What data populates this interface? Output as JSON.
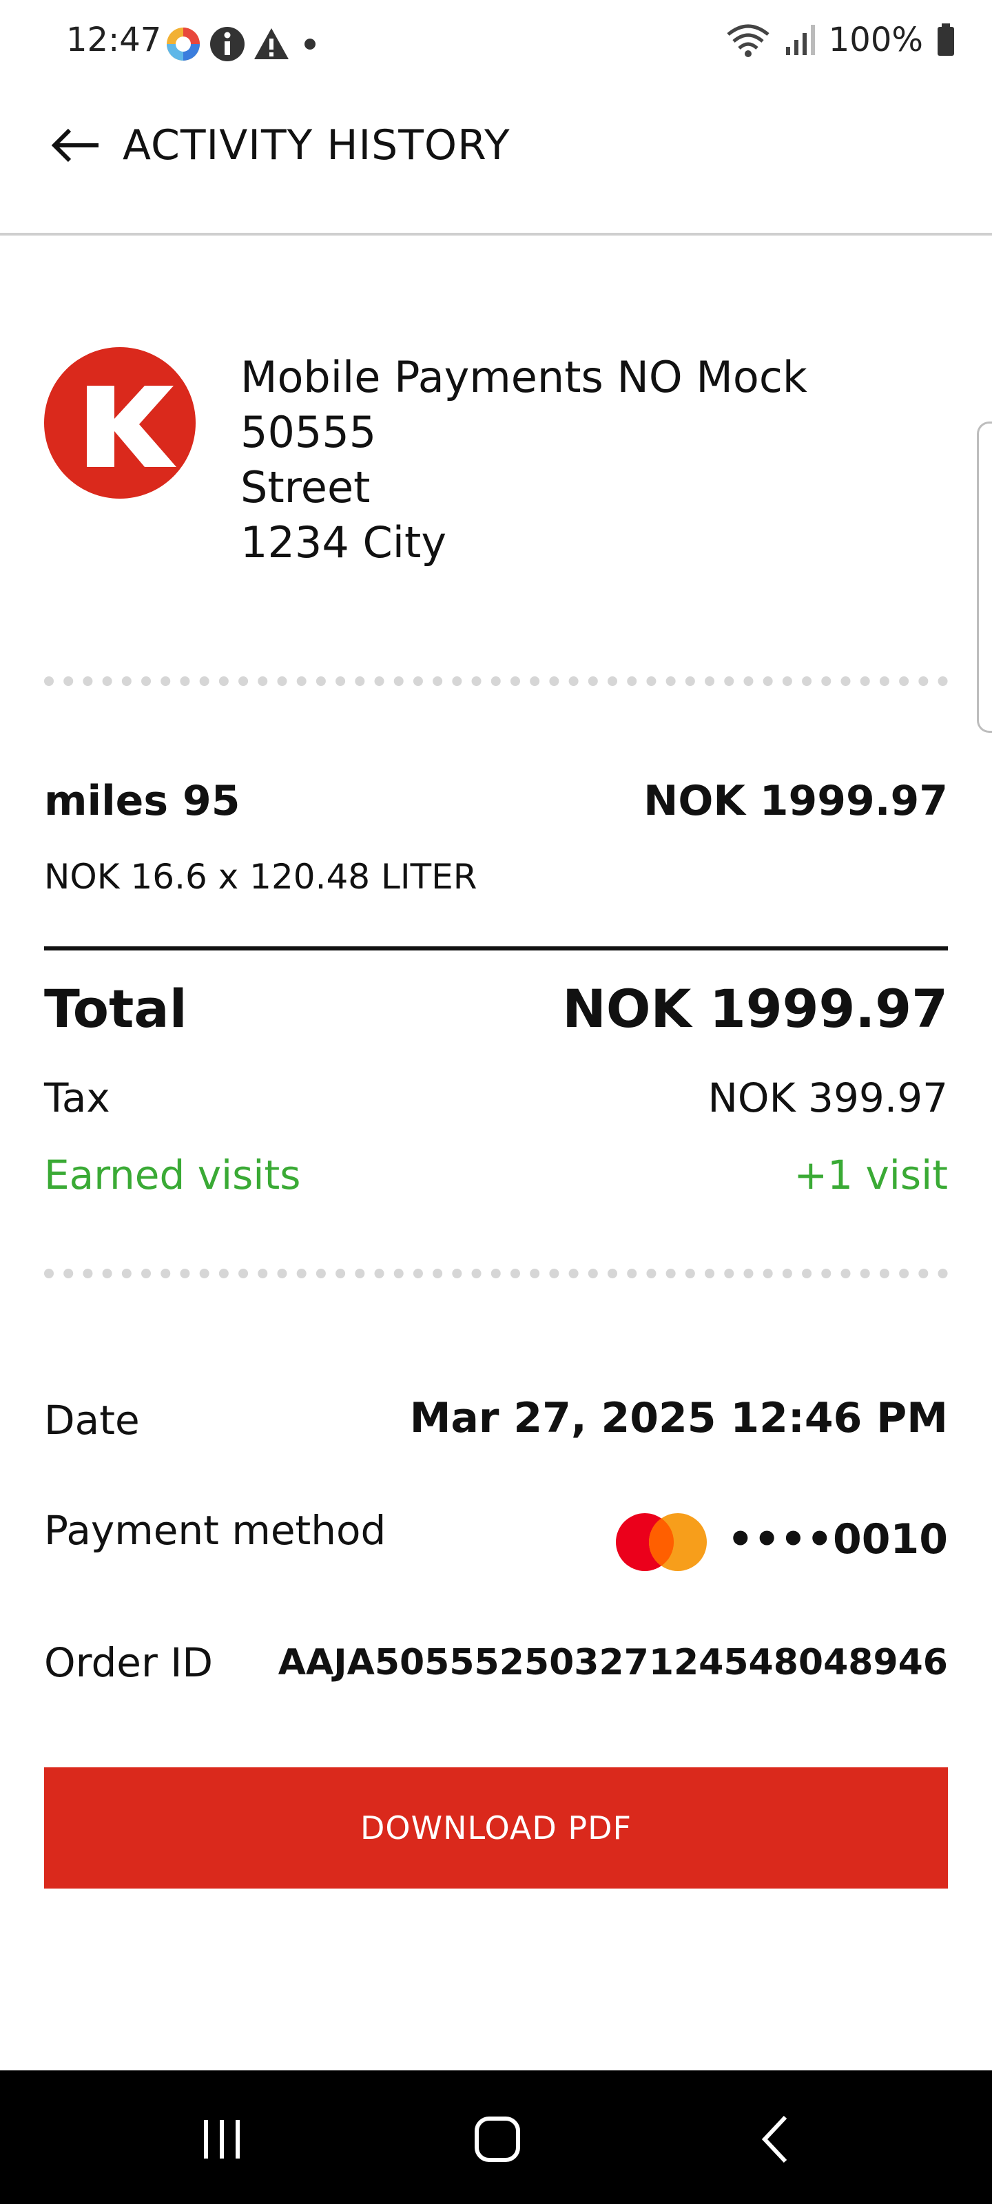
{
  "status_bar": {
    "time": "12:47",
    "battery": "100%",
    "icons": [
      "app-notification-icon",
      "info-icon",
      "warning-icon",
      "dot-icon",
      "wifi-icon",
      "signal-icon",
      "battery-icon"
    ]
  },
  "app_bar": {
    "back_icon": "arrow-left-icon",
    "title": "ACTIVITY HISTORY"
  },
  "merchant": {
    "logo": "circle-k-logo",
    "name": "Mobile Payments NO Mock",
    "id": "50555",
    "street": "Street",
    "city": "1234 City"
  },
  "item": {
    "name": "miles 95",
    "price": "NOK 1999.97",
    "detail": "NOK 16.6 x 120.48 LITER"
  },
  "summary": {
    "total_label": "Total",
    "total_value": "NOK 1999.97",
    "tax_label": "Tax",
    "tax_value": "NOK 399.97",
    "visits_label": "Earned visits",
    "visits_value": "+1 visit"
  },
  "details": {
    "date_label": "Date",
    "date_value": "Mar 27, 2025 12:46 PM",
    "payment_label": "Payment method",
    "payment_card": "mastercard-icon",
    "payment_value": "••••0010",
    "order_label": "Order ID",
    "order_value": "AAJA50555250327124548048946"
  },
  "actions": {
    "download_label": "DOWNLOAD PDF"
  },
  "colors": {
    "brand_red": "#da291c",
    "success_green": "#3aaa35",
    "text": "#111111"
  },
  "nav_bar": {
    "icons": [
      "recents-icon",
      "home-icon",
      "back-icon"
    ]
  }
}
